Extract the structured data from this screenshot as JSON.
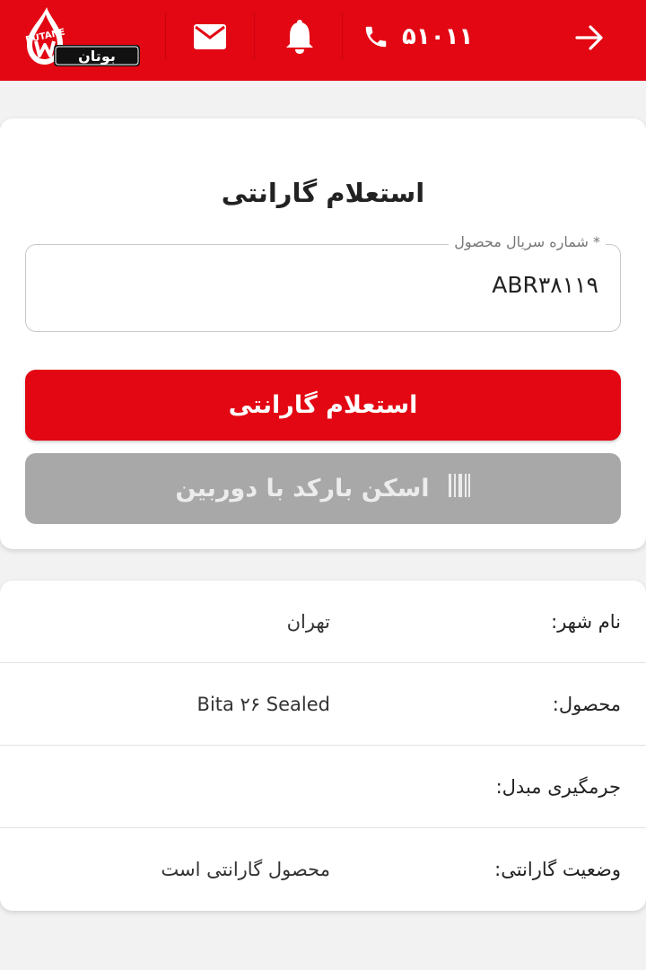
{
  "header": {
    "phone_number": "۵۱۰۱۱",
    "brand_color": "#e30613",
    "icons": {
      "logo": "butane-logo",
      "mail": "mail-icon",
      "bell": "bell-icon",
      "phone": "phone-icon",
      "back": "arrow-right-icon"
    },
    "logo_text_latin": "BUTANE",
    "logo_text_farsi": "بوتان"
  },
  "inquiry": {
    "title": "استعلام گارانتی",
    "serial_label": "* شماره سریال محصول",
    "serial_value": "ABR۳۸۱۱۹",
    "submit_label": "استعلام گارانتی",
    "scan_label": "اسکن بارکد با دوربین",
    "scan_icon": "barcode-icon"
  },
  "result": {
    "rows": [
      {
        "label": "نام شهر:",
        "value": "تهران"
      },
      {
        "label": "محصول:",
        "value": "Bita ۲۶ Sealed"
      },
      {
        "label": "جرمگیری مبدل:",
        "value": ""
      },
      {
        "label": "وضعیت گارانتی:",
        "value": "محصول گارانتی است"
      }
    ]
  }
}
